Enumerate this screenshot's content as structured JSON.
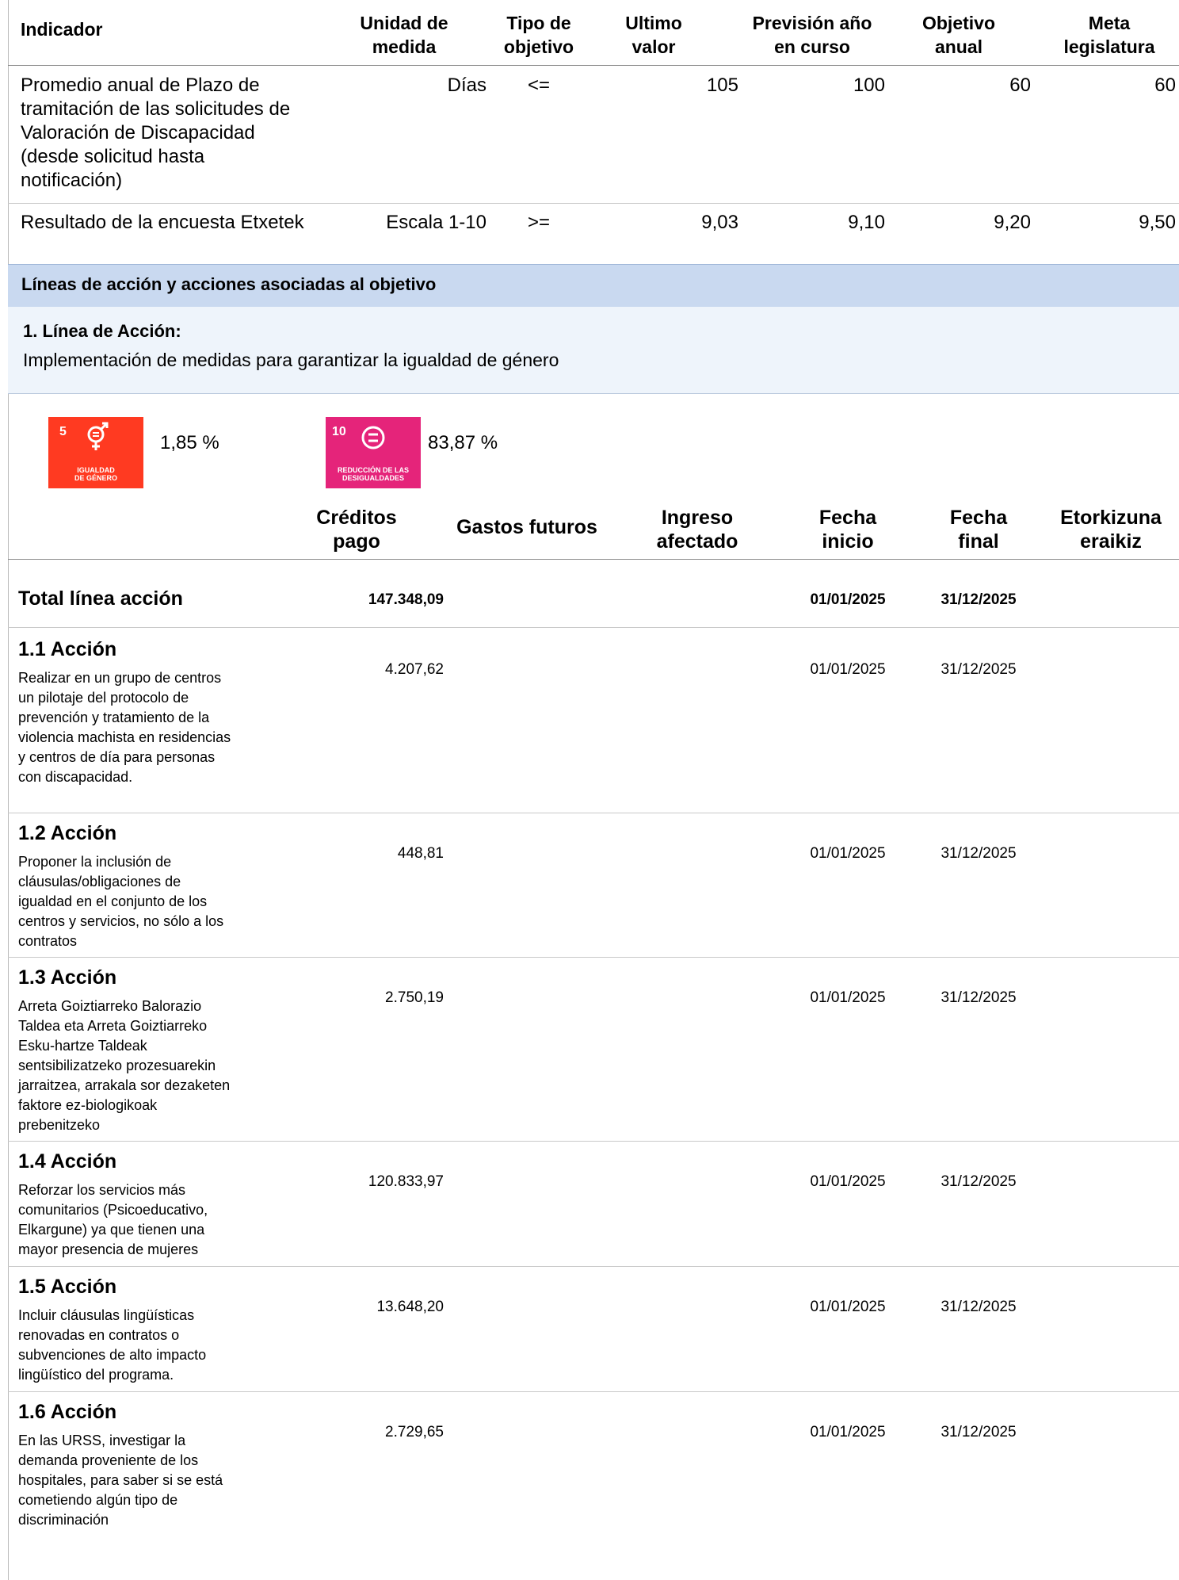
{
  "indicators_table": {
    "headers": {
      "indicador": "Indicador",
      "unidad": [
        "Unidad de",
        "medida"
      ],
      "tipo": [
        "Tipo de",
        "objetivo"
      ],
      "ultimo": [
        "Ultimo",
        "valor"
      ],
      "prevision": [
        "Previsión año",
        "en curso"
      ],
      "objetivo": [
        "Objetivo",
        "anual"
      ],
      "meta": [
        "Meta",
        "legislatura"
      ]
    },
    "rows": [
      {
        "indicador": [
          "Promedio anual de Plazo de",
          "tramitación de las solicitudes de",
          "Valoración de Discapacidad",
          "(desde solicitud hasta",
          "notificación)"
        ],
        "unidad": "Días",
        "tipo": "<=",
        "ultimo": "105",
        "prevision": "100",
        "objetivo": "60",
        "meta": "60"
      },
      {
        "indicador": [
          "Resultado de la encuesta Etxetek"
        ],
        "unidad": "Escala 1-10",
        "tipo": ">=",
        "ultimo": "9,03",
        "prevision": "9,10",
        "objetivo": "9,20",
        "meta": "9,50"
      }
    ]
  },
  "section": {
    "title": "Líneas de acción y acciones asociadas al objetivo",
    "line_label": "1. Línea de Acción:",
    "line_text": "Implementación de medidas para garantizar la igualdad de género"
  },
  "ods": [
    {
      "number": "5",
      "caption": [
        "IGUALDAD",
        "DE GÉNERO"
      ],
      "percent": "1,85 %",
      "color": "#ff3a21",
      "icon": "gender-equality-icon"
    },
    {
      "number": "10",
      "caption": [
        "REDUCCIÓN DE LAS",
        "DESIGUALDADES"
      ],
      "percent": "83,87 %",
      "color": "#e5247a",
      "icon": "reduced-inequalities-icon"
    }
  ],
  "actions_table": {
    "headers": {
      "creditos": [
        "Créditos",
        "pago"
      ],
      "gastos": "Gastos futuros",
      "ingreso": [
        "Ingreso",
        "afectado"
      ],
      "inicio": [
        "Fecha",
        "inicio"
      ],
      "final": [
        "Fecha",
        "final"
      ],
      "etorkizuna": [
        "Etorkizuna",
        "eraikiz"
      ]
    },
    "total": {
      "label": "Total línea acción",
      "creditos": "147.348,09",
      "inicio": "01/01/2025",
      "final": "31/12/2025"
    },
    "actions": [
      {
        "title": "1.1 Acción",
        "desc": [
          "Realizar en un grupo de centros",
          "un pilotaje del protocolo de",
          "prevención y tratamiento de la",
          "violencia machista en residencias",
          "y centros de día para personas",
          "con discapacidad."
        ],
        "creditos": "4.207,62",
        "inicio": "01/01/2025",
        "final": "31/12/2025"
      },
      {
        "title": "1.2 Acción",
        "desc": [
          "Proponer la inclusión de",
          "cláusulas/obligaciones de",
          "igualdad en el conjunto de los",
          "centros y servicios, no sólo a los",
          "contratos"
        ],
        "creditos": "448,81",
        "inicio": "01/01/2025",
        "final": "31/12/2025"
      },
      {
        "title": "1.3 Acción",
        "desc": [
          "Arreta Goiztiarreko Balorazio",
          "Taldea eta Arreta Goiztiarreko",
          "Esku-hartze Taldeak",
          "sentsibilizatzeko prozesuarekin",
          "jarraitzea, arrakala sor dezaketen",
          "faktore ez-biologikoak",
          "prebenitzeko"
        ],
        "creditos": "2.750,19",
        "inicio": "01/01/2025",
        "final": "31/12/2025"
      },
      {
        "title": "1.4 Acción",
        "desc": [
          "Reforzar los servicios más",
          "comunitarios (Psicoeducativo,",
          "Elkargune) ya que tienen una",
          "mayor presencia de mujeres"
        ],
        "creditos": "120.833,97",
        "inicio": "01/01/2025",
        "final": "31/12/2025"
      },
      {
        "title": "1.5 Acción",
        "desc": [
          "Incluir cláusulas lingüísticas",
          "renovadas en contratos o",
          "subvenciones de alto impacto",
          "lingüístico del programa."
        ],
        "creditos": "13.648,20",
        "inicio": "01/01/2025",
        "final": "31/12/2025"
      },
      {
        "title": "1.6 Acción",
        "desc": [
          "En las URSS, investigar la",
          "demanda proveniente de los",
          "hospitales, para saber si se está",
          "cometiendo algún tipo de",
          "discriminación"
        ],
        "creditos": "2.729,65",
        "inicio": "01/01/2025",
        "final": "31/12/2025"
      }
    ]
  }
}
